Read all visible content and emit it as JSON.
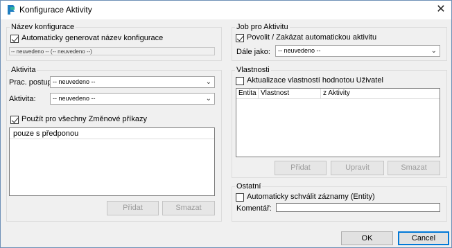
{
  "window": {
    "title": "Konfigurace Aktivity",
    "close_glyph": "✕"
  },
  "nazev": {
    "title": "Název konfigurace",
    "auto_label": "Automaticky generovat název konfigurace",
    "auto_checked": true,
    "value": "-- neuvedeno -- (-- neuvedeno --)"
  },
  "aktivita": {
    "title": "Aktivita",
    "prac_label": "Prac. postup:",
    "prac_value": "-- neuvedeno --",
    "aktivita_label": "Aktivita:",
    "aktivita_value": "-- neuvedeno --",
    "pouzit_label": "Použít pro všechny Změnové příkazy",
    "pouzit_checked": true,
    "list_header": "pouze s předponou",
    "pridat": "Přidat",
    "smazat": "Smazat"
  },
  "job": {
    "title": "Job pro Aktivitu",
    "povolit_label": "Povolit / Zakázat automatickou aktivitu",
    "povolit_checked": true,
    "dale_label": "Dále jako:",
    "dale_value": "-- neuvedeno --"
  },
  "vlastnosti": {
    "title": "Vlastnosti",
    "akt_label": "Aktualizace vlastností hodnotou Uživatel",
    "akt_checked": false,
    "columns": [
      "Entita",
      "Vlastnost",
      "z Aktivity"
    ],
    "pridat": "Přidat",
    "upravit": "Upravit",
    "smazat": "Smazat"
  },
  "ostatni": {
    "title": "Ostatní",
    "schvalit_label": "Automaticky schválit záznamy (Entity)",
    "schvalit_checked": false,
    "komentar_label": "Komentář:",
    "komentar_value": ""
  },
  "buttons": {
    "ok": "OK",
    "cancel": "Cancel"
  },
  "colors": {
    "accent": "#0078d7",
    "window_border": "#6c8fb6",
    "dialog_bg": "#f0f0f0"
  }
}
